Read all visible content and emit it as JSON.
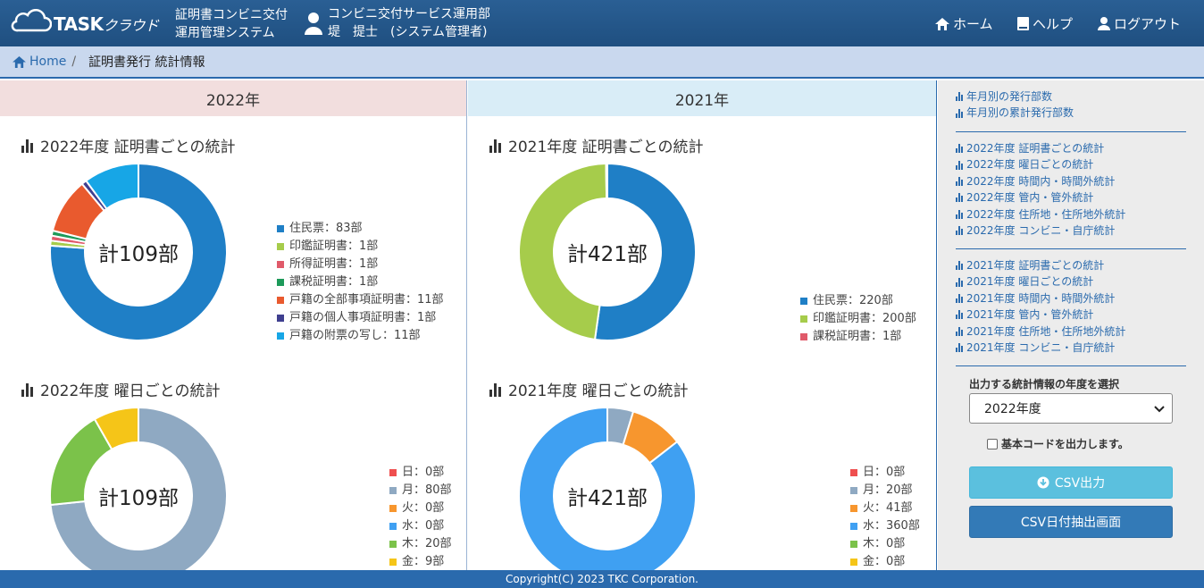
{
  "header": {
    "logo_main": "TASK",
    "logo_sub": "クラウド",
    "system_line1": "証明書コンビニ交付",
    "system_line2": "運用管理システム",
    "user_line1": "コンビニ交付サービス運用部",
    "user_line2": "堤　提士　(システム管理者)",
    "nav": {
      "home": "ホーム",
      "help": "ヘルプ",
      "logout": "ログアウト"
    }
  },
  "breadcrumb": {
    "home": "Home",
    "separator": "/",
    "current": "証明書発行 統計情報"
  },
  "columns": [
    {
      "year_label": "2022年",
      "charts": [
        {
          "title": "2022年度 証明書ごとの統計",
          "total_label": "計109部",
          "legend": [
            {
              "label": "住民票：83部",
              "value": 83,
              "color": "#1f7fc6"
            },
            {
              "label": "印鑑証明書：1部",
              "value": 1,
              "color": "#a6cc4b"
            },
            {
              "label": "所得証明書：1部",
              "value": 1,
              "color": "#e05a6a"
            },
            {
              "label": "課税証明書：1部",
              "value": 1,
              "color": "#1d9a5a"
            },
            {
              "label": "戸籍の全部事項証明書：11部",
              "value": 11,
              "color": "#e95a2e"
            },
            {
              "label": "戸籍の個人事項証明書：1部",
              "value": 1,
              "color": "#3f3f8f"
            },
            {
              "label": "戸籍の附票の写し：11部",
              "value": 11,
              "color": "#17a6e6"
            }
          ]
        },
        {
          "title": "2022年度 曜日ごとの統計",
          "total_label": "計109部",
          "legend": [
            {
              "label": "日：0部",
              "value": 0,
              "color": "#ef4f4f"
            },
            {
              "label": "月：80部",
              "value": 80,
              "color": "#8fa9c2"
            },
            {
              "label": "火：0部",
              "value": 0,
              "color": "#f7962e"
            },
            {
              "label": "水：0部",
              "value": 0,
              "color": "#3fa0f2"
            },
            {
              "label": "木：20部",
              "value": 20,
              "color": "#7bc24a"
            },
            {
              "label": "金：9部",
              "value": 9,
              "color": "#f5c518"
            }
          ]
        }
      ]
    },
    {
      "year_label": "2021年",
      "charts": [
        {
          "title": "2021年度 証明書ごとの統計",
          "total_label": "計421部",
          "legend": [
            {
              "label": "住民票：220部",
              "value": 220,
              "color": "#1f7fc6"
            },
            {
              "label": "印鑑証明書：200部",
              "value": 200,
              "color": "#a6cc4b"
            },
            {
              "label": "課税証明書：1部",
              "value": 1,
              "color": "#e05a6a"
            }
          ]
        },
        {
          "title": "2021年度 曜日ごとの統計",
          "total_label": "計421部",
          "legend": [
            {
              "label": "日：0部",
              "value": 0,
              "color": "#ef4f4f"
            },
            {
              "label": "月：20部",
              "value": 20,
              "color": "#8fa9c2"
            },
            {
              "label": "火：41部",
              "value": 41,
              "color": "#f7962e"
            },
            {
              "label": "水：360部",
              "value": 360,
              "color": "#3fa0f2"
            },
            {
              "label": "木：0部",
              "value": 0,
              "color": "#7bc24a"
            },
            {
              "label": "金：0部",
              "value": 0,
              "color": "#f5c518"
            }
          ]
        }
      ]
    }
  ],
  "sidebar": {
    "group1": [
      "年月別の発行部数",
      "年月別の累計発行部数"
    ],
    "group2": [
      "2022年度 証明書ごとの統計",
      "2022年度 曜日ごとの統計",
      "2022年度 時間内・時間外統計",
      "2022年度 管内・管外統計",
      "2022年度 住所地・住所地外統計",
      "2022年度 コンビニ・自庁統計"
    ],
    "group3": [
      "2021年度 証明書ごとの統計",
      "2021年度 曜日ごとの統計",
      "2021年度 時間内・時間外統計",
      "2021年度 管内・管外統計",
      "2021年度 住所地・住所地外統計",
      "2021年度 コンビニ・自庁統計"
    ],
    "select_label": "出力する統計情報の年度を選択",
    "select_value": "2022年度",
    "checkbox_label": "基本コードを出力します。",
    "csv_button": "CSV出力",
    "date_button": "CSV日付抽出画面"
  },
  "footer": {
    "copyright": "Copyright(C) 2023 TKC Corporation."
  }
}
